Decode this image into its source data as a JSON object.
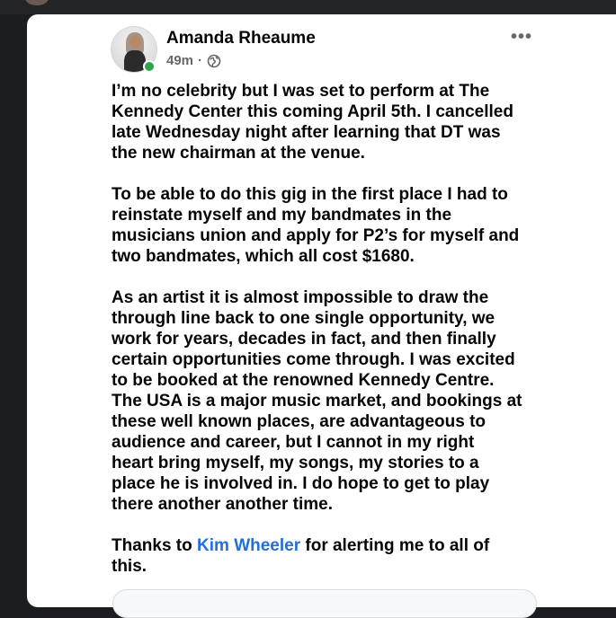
{
  "post": {
    "author": "Amanda Rheaume",
    "time": "49m",
    "separator": "·",
    "audience_icon": "globe-icon",
    "more_label": "•••",
    "paragraphs": [
      [
        "I’m no celebrity but I was set to perform at The",
        "Kennedy Center this coming April 5th. I cancelled",
        "late Wednesday night after learning that DT was",
        "the new chairman at the venue."
      ],
      [
        "To be able to do this gig in the first place I had to",
        "reinstate myself and my bandmates in the",
        "musicians union and apply for P2’s for myself and",
        "two bandmates, which all cost $1680."
      ],
      [
        "As an artist it is almost impossible to draw the",
        "through line back to one single opportunity, we",
        "work for years, decades in fact, and then finally",
        "certain opportunities come through. I was excited",
        "to be booked at the renowned Kennedy Centre.",
        "The USA is a major music market, and bookings at",
        "these well known places, are advantageous to",
        "audience and career, but I cannot in my right",
        "heart bring myself, my songs, my stories to a",
        "place he is involved in. I do hope to get to play",
        "there another another time."
      ]
    ],
    "closing": {
      "prefix": "Thanks to ",
      "mention": "Kim Wheeler",
      "suffix": " for alerting me to all of",
      "line2": "this."
    }
  },
  "colors": {
    "background": "#1c1d20",
    "card": "#ffffff",
    "text": "#050505",
    "meta": "#65676b",
    "mention": "#216fdb",
    "online": "#31a24c"
  }
}
